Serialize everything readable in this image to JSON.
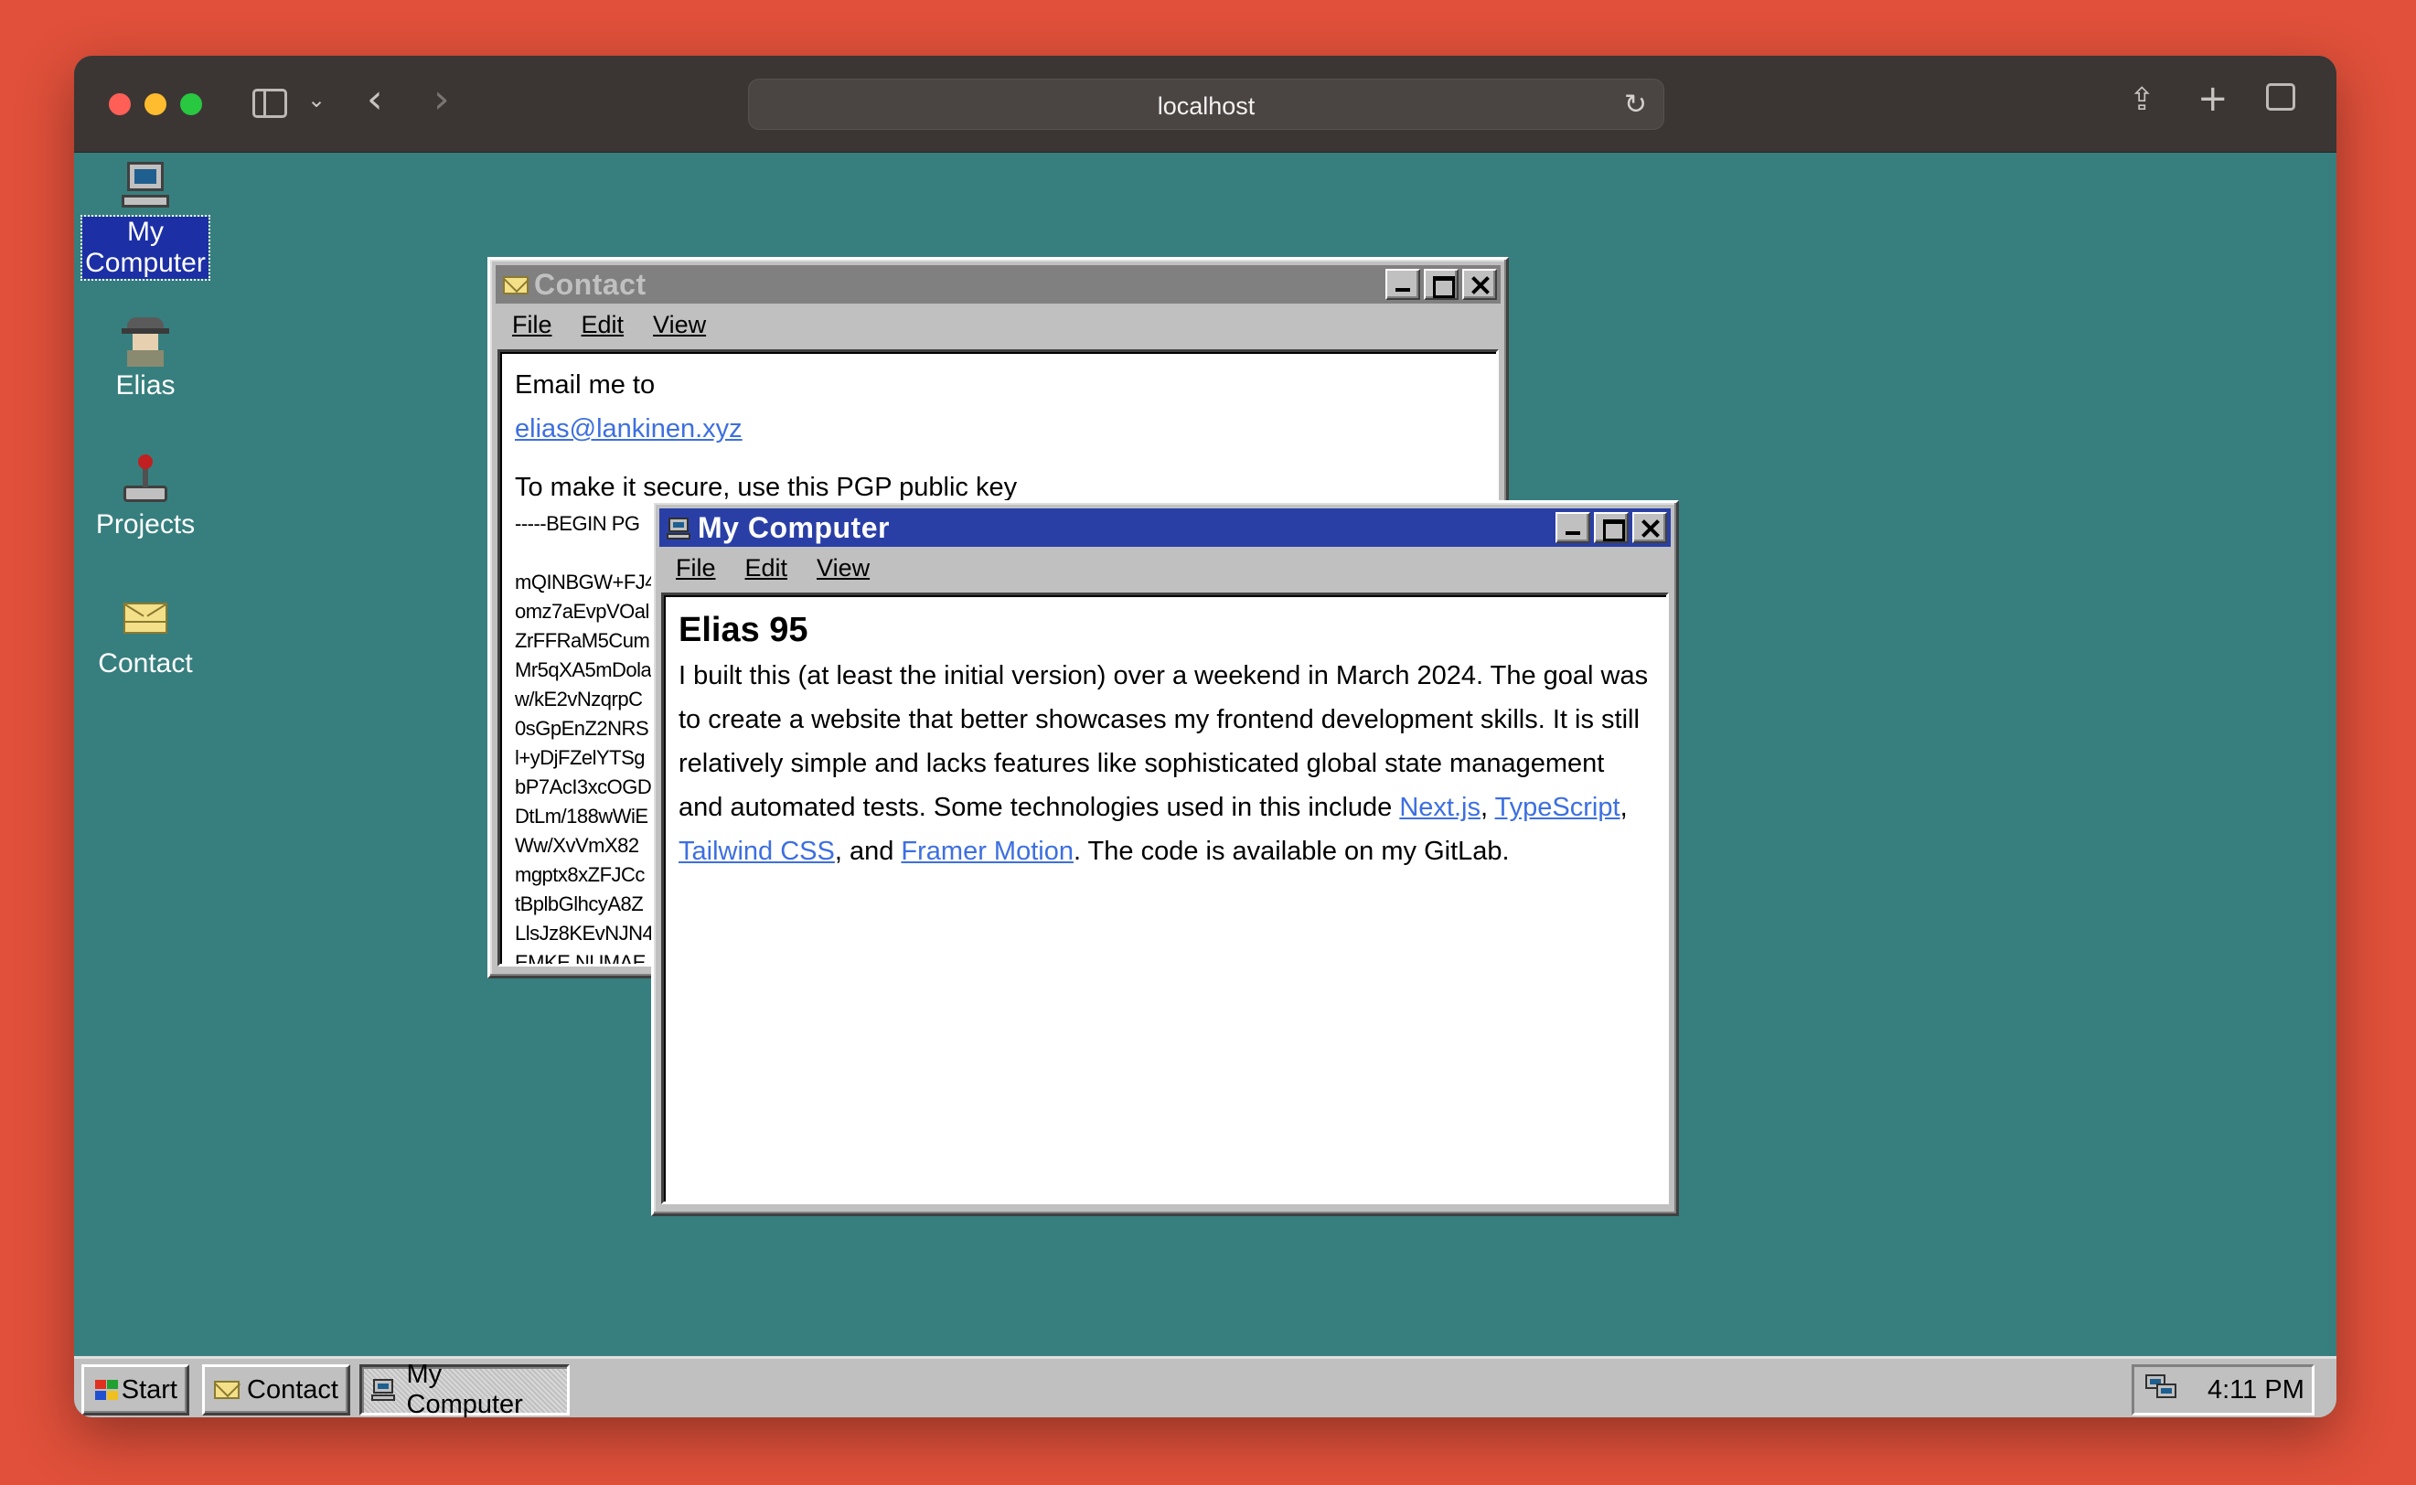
{
  "browser": {
    "address": "localhost"
  },
  "desktop": {
    "icons": [
      {
        "label_line1": "My",
        "label_line2": "Computer",
        "icon": "computer-icon",
        "selected": true
      },
      {
        "label": "Elias",
        "icon": "spy-icon"
      },
      {
        "label": "Projects",
        "icon": "joystick-icon"
      },
      {
        "label": "Contact",
        "icon": "envelope-icon"
      }
    ]
  },
  "contact_window": {
    "title": "Contact",
    "menu": [
      "File",
      "Edit",
      "View"
    ],
    "email_intro": "Email me to",
    "email": "elias@lankinen.xyz",
    "pgp_intro": "To make it secure, use this PGP public key",
    "pgp_lines": [
      "-----BEGIN PG",
      "",
      "mQINBGW+FJ4",
      "omz7aEvpVOal",
      "ZrFFRaM5Cum",
      "Mr5qXA5mDola",
      "w/kE2vNzqrpC",
      "0sGpEnZ2NRS",
      "l+yDjFZelYTSg",
      "bP7AcI3xcOGD",
      "DtLm/188wWiE",
      "Ww/XvVmX82",
      "mgptx8xZFJCc",
      "tBplbGlhcyA8Z",
      "LlsJz8KEvNJN4",
      "EMKE NUMAE"
    ]
  },
  "mycomputer_window": {
    "title": "My Computer",
    "menu": [
      "File",
      "Edit",
      "View"
    ],
    "heading": "Elias 95",
    "body_before": "I built this (at least the initial version) over a weekend in March 2024. The goal was to create a website that better showcases my frontend development skills. It is still relatively simple and lacks features like sophisticated global state management and automated tests. Some technologies used in this include ",
    "link_next": "Next.js",
    "sep1": ", ",
    "link_ts": "TypeScript",
    "sep2": ", ",
    "link_tailwind": "Tailwind CSS",
    "sep3": ", and ",
    "link_framer": "Framer Motion",
    "body_after": ". The code is available on my GitLab."
  },
  "taskbar": {
    "start": "Start",
    "tasks": [
      {
        "label": "Contact",
        "icon": "envelope-icon",
        "pressed": false
      },
      {
        "label": "My Computer",
        "icon": "computer-icon",
        "pressed": true
      }
    ],
    "clock": "4:11 PM"
  },
  "colors": {
    "desktop": "#377f7e",
    "active_title": "#2a3fa6",
    "inactive_title": "#808080",
    "link": "#3d6fe0",
    "page_background": "#e0503a"
  }
}
